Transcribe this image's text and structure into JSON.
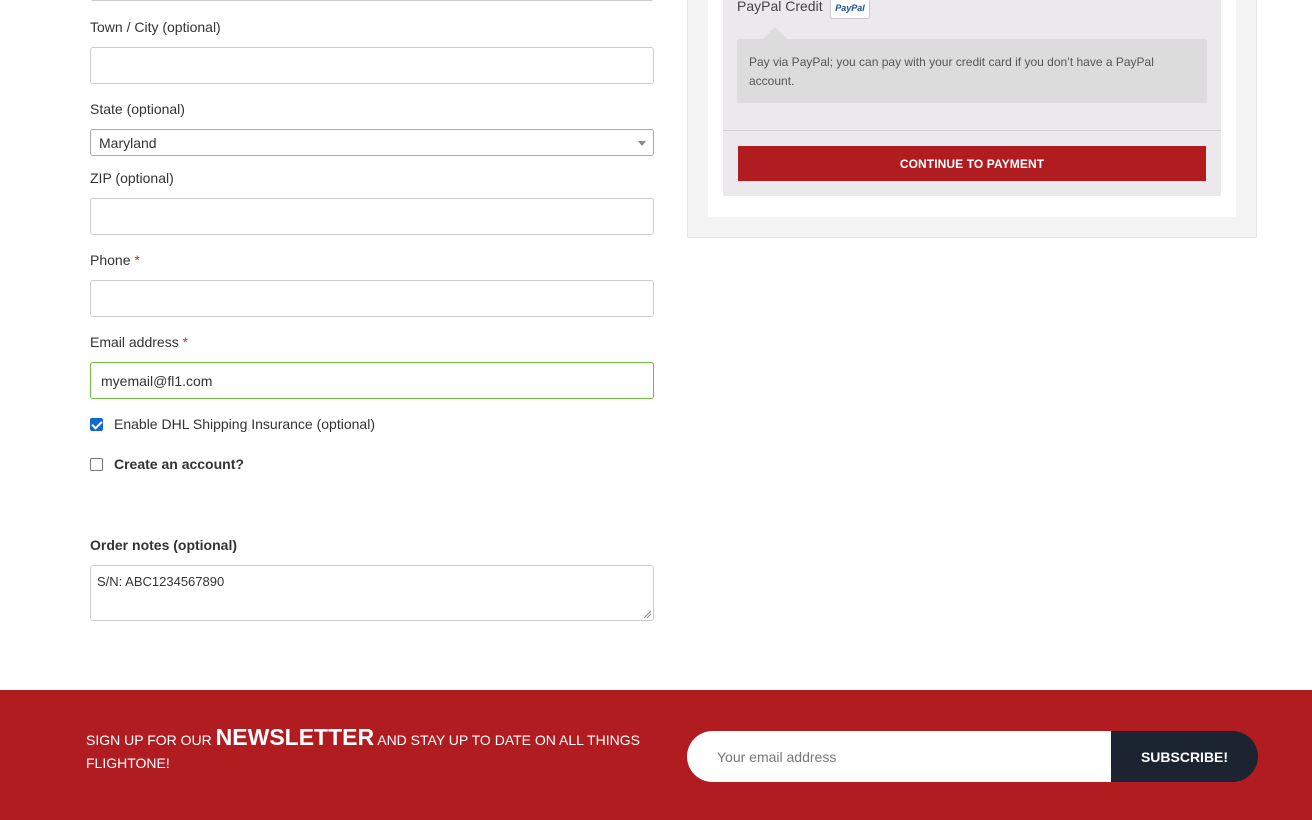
{
  "billing": {
    "town_label": "Town / City (optional)",
    "town_value": "",
    "state_label": "State (optional)",
    "state_value": "Maryland",
    "zip_label": "ZIP (optional)",
    "zip_value": "",
    "phone_label": "Phone",
    "phone_value": "",
    "email_label": "Email address",
    "email_value": "myemail@fl1.com",
    "required_mark": "*",
    "dhl_insurance_label": "Enable DHL Shipping Insurance (optional)",
    "dhl_insurance_checked": true,
    "create_account_label": "Create an account?",
    "create_account_checked": false,
    "order_notes_label": "Order notes (optional)",
    "order_notes_value": "S/N: ABC1234567890"
  },
  "payment": {
    "method_label": "PayPal Credit",
    "logo_text": "PayPal",
    "description": "Pay via PayPal; you can pay with your credit card if you don’t have a PayPal account.",
    "continue_button": "CONTINUE TO PAYMENT"
  },
  "newsletter": {
    "text_before": "SIGN UP FOR OUR ",
    "text_big": "NEWSLETTER",
    "text_after": " AND STAY UP TO DATE ON ALL THINGS FLIGHTONE!",
    "email_placeholder": "Your email address",
    "subscribe_button": "SUBSCRIBE!"
  },
  "colors": {
    "brand_red": "#b01c20",
    "dark_button": "#1c2431",
    "valid_border": "#6dbd42",
    "checkbox_blue": "#0b6bd3"
  }
}
